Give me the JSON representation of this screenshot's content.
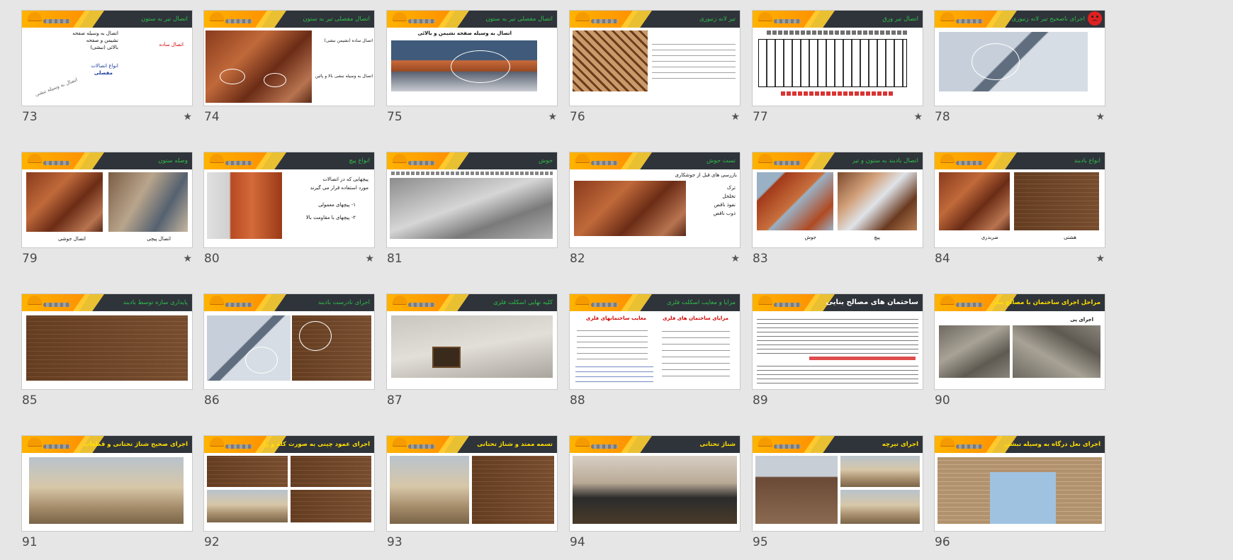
{
  "slides": [
    {
      "number": "73",
      "title": "اتصال تیر به ستون",
      "starred": true
    },
    {
      "number": "74",
      "title": "اتصال مفصلی تیر به ستون",
      "starred": false
    },
    {
      "number": "75",
      "title": "اتصال مفصلی تیر به ستون",
      "starred": true
    },
    {
      "number": "76",
      "title": "تیر لانه زنبوری",
      "starred": true
    },
    {
      "number": "77",
      "title": "اتصال تیر ورق",
      "starred": true
    },
    {
      "number": "78",
      "title": "اجرای ناصحیح تیر لانه زنبوری",
      "starred": true
    },
    {
      "number": "79",
      "title": "وصله ستون",
      "starred": true
    },
    {
      "number": "80",
      "title": "انواع پیچ",
      "starred": true
    },
    {
      "number": "81",
      "title": "جوش",
      "starred": false
    },
    {
      "number": "82",
      "title": "تست جوش",
      "starred": true
    },
    {
      "number": "83",
      "title": "اتصال بادبند به ستون و تیر",
      "starred": false
    },
    {
      "number": "84",
      "title": "انواع بادبند",
      "starred": true
    },
    {
      "number": "85",
      "title": "پایداری سازه توسط بادبند",
      "starred": false
    },
    {
      "number": "86",
      "title": "اجرای نادرست بادبند",
      "starred": false
    },
    {
      "number": "87",
      "title": "کلیه نهایی اسکلت فلزی",
      "starred": false
    },
    {
      "number": "88",
      "title": "مزایا و معایب اسکلت فلزی",
      "starred": false
    },
    {
      "number": "89",
      "title": "ساختمان های مصالح بنایی",
      "starred": false
    },
    {
      "number": "90",
      "title": "مراحل اجرای ساختمان با مصالح بنایی",
      "starred": false
    },
    {
      "number": "91",
      "title": "اجرای صحیح شناژ تحتانی و قطعات",
      "starred": false
    },
    {
      "number": "92",
      "title": "اجرای عمود چینی به صورت کله و راسته",
      "starred": false
    },
    {
      "number": "93",
      "title": "تسمه ممتد و شناژ تحتانی",
      "starred": false
    },
    {
      "number": "94",
      "title": "شناژ تحتانی",
      "starred": false
    },
    {
      "number": "95",
      "title": "اجرای تیرچه",
      "starred": false
    },
    {
      "number": "96",
      "title": "اجرای نعل درگاه به وسیله نبشی",
      "starred": false
    }
  ],
  "star_glyph": "★",
  "texts": {
    "s73": [
      "اتصال به وسیله صفحه",
      "نشیمن و صفحه",
      "بالائی (نبشی)",
      "انواع اتصالات",
      "مفصلی",
      "اتصال ساده",
      "اتصال به وسیله نبشی"
    ],
    "s74": [
      "اتصال ساده (نشیمن نبشی)",
      "اتصال به وسیله نبشی بالا و پائین"
    ],
    "s75": [
      "اتصال به وسیله صفحه نشیمن و بالائی"
    ],
    "s79": [
      "اتصال جوشی",
      "اتصال پیچی"
    ],
    "s80": [
      "پیچهایی که در اتصالات",
      "مورد استفاده قرار می گیرند",
      "۱- پیچهای معمولی",
      "۲- پیچهای با مقاومت بالا"
    ],
    "s82": [
      "بازرسی های قبل از جوشکاری",
      "ترک",
      "تخلخل",
      "نفوذ ناقص",
      "ذوب ناقص"
    ],
    "s83": [
      "جوش",
      "پیچ"
    ],
    "s84": [
      "ضربدری",
      "هشتی"
    ],
    "s88": [
      "مزایای ساختمان های فلزی",
      "معایب ساختمانهای فلزی"
    ],
    "s89": [
      "ساختمان های مصالح بنایی"
    ],
    "s90": [
      "اجرای پی"
    ]
  }
}
